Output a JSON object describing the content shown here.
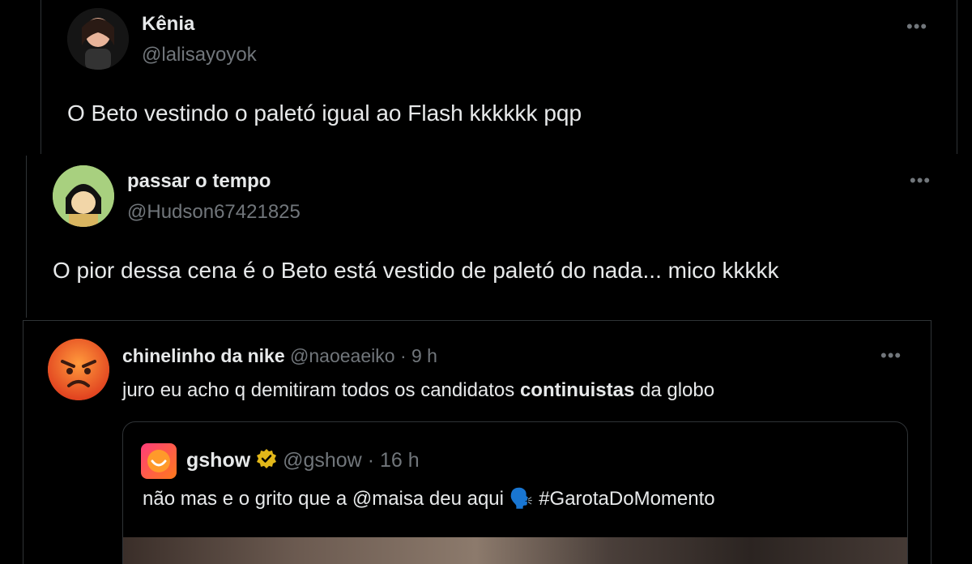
{
  "tweet1": {
    "name": "Kênia",
    "handle": "@lalisayoyok",
    "text": "O Beto vestindo o paletó igual ao Flash kkkkkk pqp",
    "more": "•••",
    "avatar_colors": [
      "#1a1a1a",
      "#e8b49a"
    ]
  },
  "tweet2": {
    "name": "passar o tempo",
    "handle": "@Hudson67421825",
    "text": "O pior dessa cena é o Beto está vestido de paletó do nada... mico kkkkk",
    "more": "•••",
    "avatar_colors": [
      "#8fc46a",
      "#111111"
    ]
  },
  "tweet3": {
    "name": "chinelinho da nike",
    "handle": "@naoeaeiko",
    "separator": "·",
    "time": "9 h",
    "text_before": "juro eu acho q demitiram todos os candidatos ",
    "text_bold": "continuistas",
    "text_after": " da globo",
    "more": "•••",
    "avatar_emoji": "😡"
  },
  "quoted": {
    "name": "gshow",
    "verified_icon": "verified-badge-icon",
    "handle": "@gshow",
    "separator": "·",
    "time": "16 h",
    "text": "não mas e o grito que a @maisa deu aqui 🗣️ #GarotaDoMomento",
    "logo_color": "#f5523a"
  }
}
